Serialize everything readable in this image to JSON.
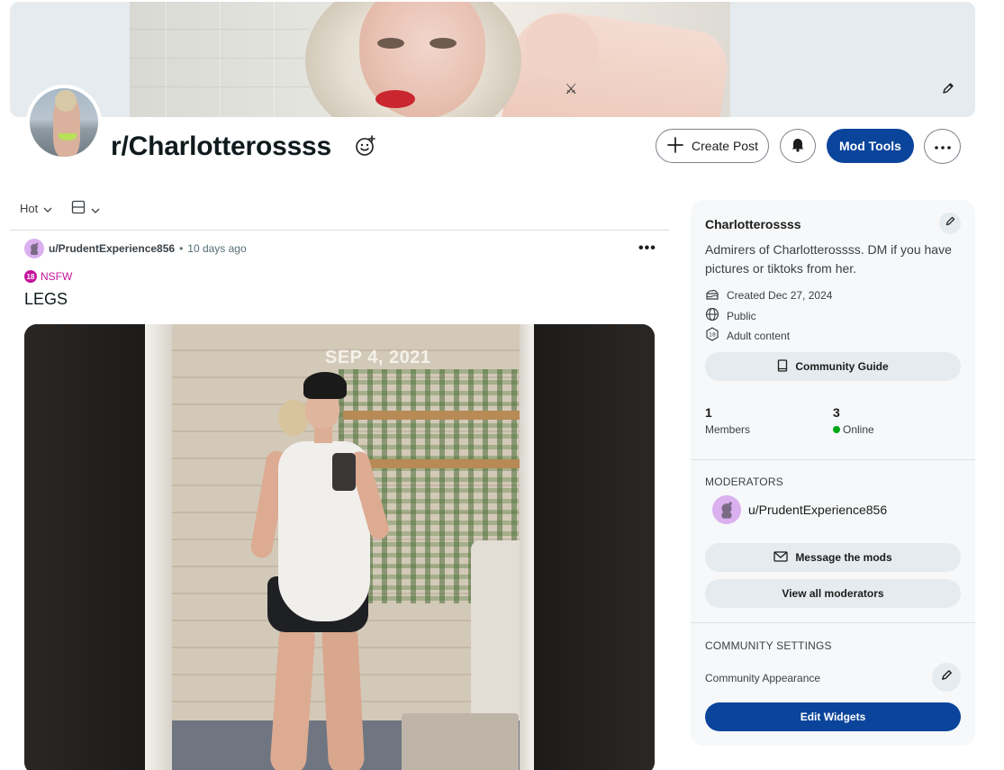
{
  "header": {
    "subreddit": "r/Charlotterossss",
    "create_post_label": "Create Post",
    "mod_tools_label": "Mod Tools",
    "icons": [
      "pencil-icon",
      "smiley-add-icon",
      "plus-icon",
      "bell-icon",
      "ellipsis-icon"
    ]
  },
  "sort": {
    "current": "Hot",
    "view_icon": "card-view-icon"
  },
  "post": {
    "author": "u/PrudentExperience856",
    "separator": "•",
    "time": "10 days ago",
    "flag": "NSFW",
    "flag_badge": "18",
    "title": "LEGS",
    "media_caption": "SEP 4, 2021",
    "more": "•••"
  },
  "sidebar": {
    "name": "Charlotterossss",
    "description": "Admirers of Charlotterossss. DM if you have pictures or tiktoks from her.",
    "created": "Created Dec 27, 2024",
    "visibility": "Public",
    "content_rating": "Adult content",
    "guide_label": "Community Guide",
    "members_count": "1",
    "members_label": "Members",
    "online_count": "3",
    "online_label": "Online",
    "moderators_heading": "MODERATORS",
    "moderator_name": "u/PrudentExperience856",
    "message_mods_label": "Message the mods",
    "view_mods_label": "View all moderators",
    "settings_heading": "COMMUNITY SETTINGS",
    "appearance_label": "Community Appearance",
    "edit_widgets_label": "Edit Widgets"
  },
  "colors": {
    "primary": "#0a449b",
    "nsfw": "#c4149d",
    "online": "#01a816",
    "sidebar_bg": "#f6f8f9"
  }
}
